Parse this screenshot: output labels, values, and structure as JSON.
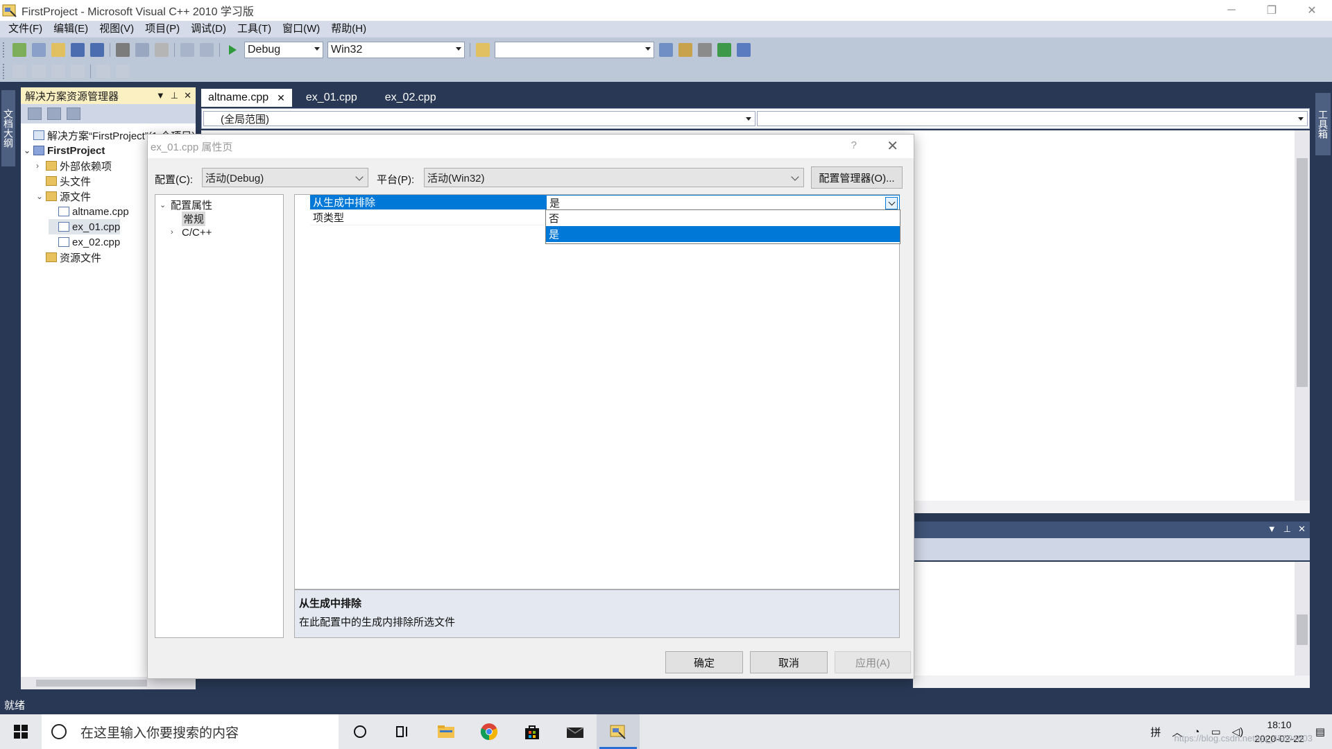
{
  "window": {
    "title": "FirstProject - Microsoft Visual C++ 2010 学习版",
    "controls": [
      "─",
      "❐",
      "✕"
    ]
  },
  "menu": [
    "文件(F)",
    "编辑(E)",
    "视图(V)",
    "项目(P)",
    "调试(D)",
    "工具(T)",
    "窗口(W)",
    "帮助(H)"
  ],
  "toolbar": {
    "config_value": "Debug",
    "platform_value": "Win32",
    "find_value": ""
  },
  "left_tab": "文档大纲",
  "right_tab": "工具箱",
  "solution_explorer": {
    "title": "解决方案资源管理器",
    "nodes": [
      {
        "label": "解决方案“FirstProject”(1 个项目)",
        "icon": "solution-icon"
      },
      {
        "label": "FirstProject",
        "icon": "project-icon"
      },
      {
        "label": "外部依赖项",
        "icon": "folder-icon"
      },
      {
        "label": "头文件",
        "icon": "folder-icon"
      },
      {
        "label": "源文件",
        "icon": "folder-icon"
      },
      {
        "label": "altname.cpp",
        "icon": "cpp-file-icon"
      },
      {
        "label": "ex_01.cpp",
        "icon": "cpp-file-icon"
      },
      {
        "label": "ex_02.cpp",
        "icon": "cpp-file-icon"
      },
      {
        "label": "资源文件",
        "icon": "folder-icon"
      }
    ]
  },
  "editor": {
    "tabs": [
      "altname.cpp",
      "ex_01.cpp",
      "ex_02.cpp"
    ],
    "active_tab": "altname.cpp",
    "scope": "(全局范围)"
  },
  "status": "就绪",
  "dialog": {
    "title": "ex_01.cpp 属性页",
    "help": "?",
    "config_label": "配置(C):",
    "config_value": "活动(Debug)",
    "platform_label": "平台(P):",
    "platform_value": "活动(Win32)",
    "config_manager": "配置管理器(O)...",
    "tree": [
      {
        "label": "配置属性",
        "expander": "⌄"
      },
      {
        "label": "常规",
        "expander": ""
      },
      {
        "label": "C/C++",
        "expander": "›"
      }
    ],
    "properties": [
      {
        "name": "从生成中排除",
        "value": "是"
      },
      {
        "name": "项类型",
        "value": ""
      }
    ],
    "dropdown_options": [
      "否",
      "是"
    ],
    "dropdown_selected": "是",
    "description_title": "从生成中排除",
    "description_text": "在此配置中的生成内排除所选文件",
    "ok": "确定",
    "cancel": "取消",
    "apply": "应用(A)"
  },
  "taskbar": {
    "search_placeholder": "在这里输入你要搜索的内容",
    "ime": "拼",
    "time": "18:10",
    "date": "2020-02-22",
    "watermark": "https://blog.csdn.net/qq_45694803"
  },
  "colors": {
    "ide_background": "#293955",
    "selection": "#0078d7",
    "solution_header": "#fbf0c2"
  }
}
